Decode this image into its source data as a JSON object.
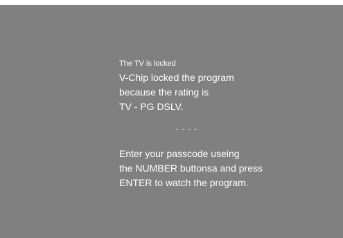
{
  "colors": {
    "screen_background": "#808080",
    "text": "#ffffff",
    "outer_background": "#ffffff"
  },
  "lock_screen": {
    "title": "The TV is locked",
    "message_lines": [
      "V-Chip locked the program",
      "because the rating is",
      "TV - PG DSLV."
    ],
    "passcode_placeholder": "- - - -",
    "instruction_lines": [
      "Enter your passcode useing",
      "the NUMBER buttonsa and press",
      "ENTER to watch the program."
    ]
  }
}
